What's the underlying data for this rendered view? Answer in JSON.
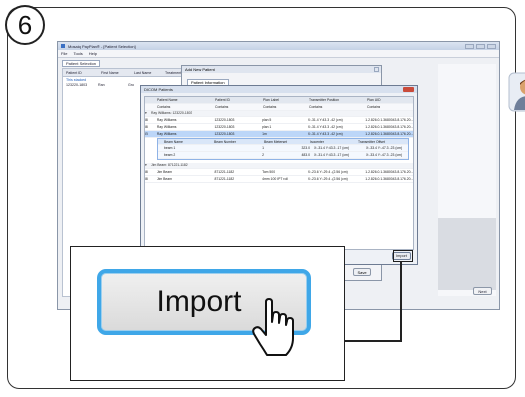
{
  "step": "6",
  "window": {
    "title": "Mosaiq PayPlan® - [Patient Selection]",
    "menu": [
      "File",
      "Tools",
      "Help"
    ],
    "tab": "Patient Selection",
    "next_label": "Next"
  },
  "patient_list": {
    "columns": [
      "Patient ID",
      "First Name",
      "Last Name",
      "Treatments"
    ],
    "selected_label": "This stacked",
    "row": [
      "123220-1803",
      "Ran",
      "Gro"
    ]
  },
  "add_patient_dialog": {
    "title": "Add New Patient",
    "tab": "Patient Information",
    "right_tab": "Patient Information",
    "save_label": "Save"
  },
  "dicom_dialog": {
    "title": "DICOM Patients",
    "columns": [
      "Patient Name",
      "Patient ID",
      "Plan Label",
      "Transmitter Position",
      "Plan UID"
    ],
    "filter_text": [
      "Contains",
      "Contains",
      "Contains",
      "Contains",
      "Contains"
    ],
    "group1": "Ray Williams: 123220-1803",
    "rows": [
      [
        "Ray Williams",
        "123220-1803",
        "plan 5",
        "X:-31.4 Y:43.3 -42 (cm)",
        "1.2.826.0.1.3680043.8.176.20..."
      ],
      [
        "Ray Williams",
        "123220-1803",
        "plan 1",
        "X:-31.4 Y:43.3 -42 (cm)",
        "1.2.826.0.1.3680043.8.176.20..."
      ],
      [
        "Ray Williams",
        "123220-1803",
        "1m",
        "X:-31.4 Y:43.3 -42 (cm)",
        "1.2.826.0.1.3680043.8.176.20..."
      ]
    ],
    "beam_columns": [
      "Beam Name",
      "Beam Number",
      "Beam Meterset",
      "Isocenter",
      "Transmitter Offset"
    ],
    "beams": [
      [
        "beam 1",
        "1",
        "323.0",
        "X:-31.4 Y:43.3 -17 (cm)",
        "X:-33.4 Y:-47.3 -23 (cm)"
      ],
      [
        "beam 2",
        "2",
        "483.0",
        "X:-31.4 Y:43.3 -17 (cm)",
        "X:-33.4 Y:-47.3 -23 (cm)"
      ]
    ],
    "group2": "Jim Beam: 871221-1182",
    "rows2": [
      [
        "Jim Beam",
        "871221-1182",
        "Tom 500",
        "X:-23.6 Y:-29.4 -(2.56 (cm)",
        "1.2.826.0.1.3680043.8.176.20..."
      ],
      [
        "Jim Beam",
        "871221-1182",
        "4mm 100 IPT roll",
        "X:-23.6 Y:-29.4 -(2.56 (cm)",
        "1.2.826.0.1.3680043.8.176.20..."
      ]
    ],
    "import_label": "Import"
  },
  "zoom": {
    "import_label": "Import"
  }
}
